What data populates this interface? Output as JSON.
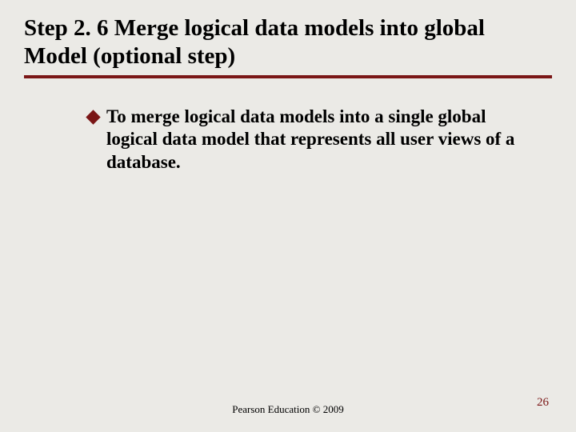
{
  "title": "Step 2. 6 Merge logical data models into global  Model (optional step)",
  "bullet": "To merge logical data models into a single global logical data model that represents all user views of a database.",
  "footer": "Pearson Education © 2009",
  "pageNumber": "26"
}
